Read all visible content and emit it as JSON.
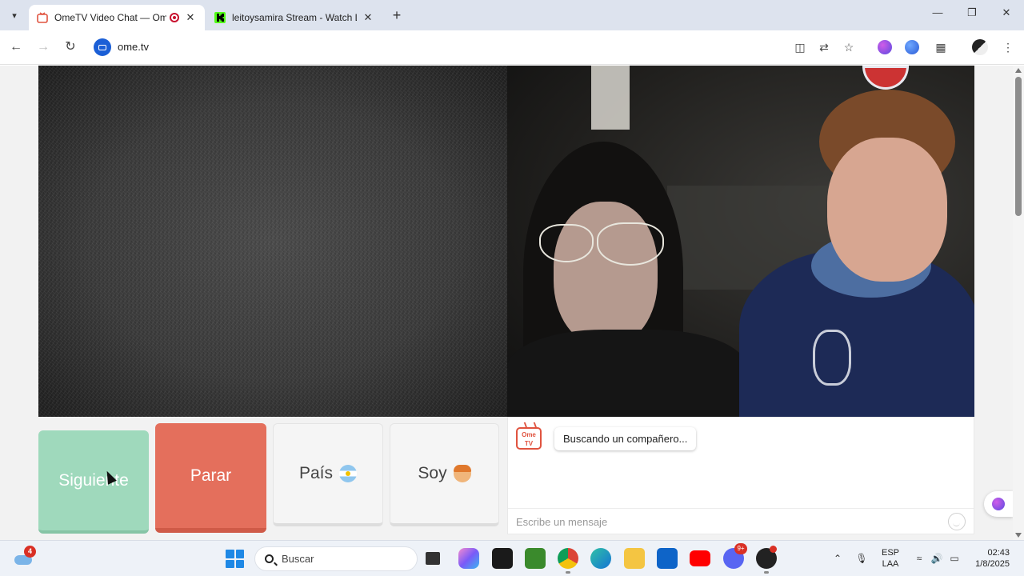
{
  "browser": {
    "tabs": [
      {
        "title": "OmeTV Video Chat — OmeTV",
        "active": true,
        "favicon": "ometv-icon",
        "recording_indicator": true
      },
      {
        "title": "leitoysamira Stream - Watch Live",
        "active": false,
        "favicon": "kick-icon"
      }
    ],
    "address": "ome.tv",
    "colors": {
      "accent": "#1b5fd6",
      "kick_green": "#53fc18",
      "record_red": "#c8102e"
    }
  },
  "page": {
    "buttons": {
      "next_label": "Siguiente",
      "stop_label": "Parar",
      "country_label": "País",
      "gender_label": "Soy"
    },
    "chat": {
      "logo_text": "Ome TV",
      "status_message": "Buscando un compañero...",
      "input_placeholder": "Escribe un mensaje"
    },
    "colors": {
      "next": "#9fd9bc",
      "stop": "#e46f5c",
      "neutral": "#f5f5f5"
    }
  },
  "taskbar": {
    "weather_badge": "4",
    "search_placeholder": "Buscar",
    "discord_badge": "9+",
    "language": "ESP",
    "keyboard_layout": "LAA",
    "time": "02:43",
    "date": "1/8/2025"
  }
}
